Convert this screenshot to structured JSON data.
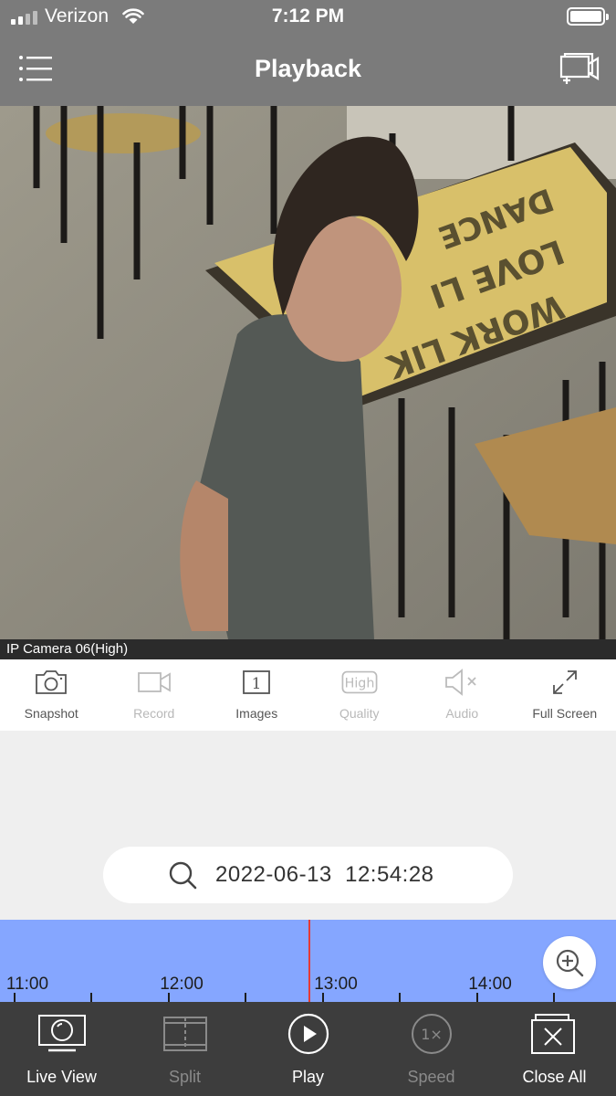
{
  "status_bar": {
    "carrier": "Verizon",
    "time": "7:12 PM"
  },
  "header": {
    "title": "Playback",
    "menu_icon": "hamburger-menu-icon",
    "add_window_icon": "add-window-icon"
  },
  "video": {
    "camera_label": "IP Camera 06(High)"
  },
  "toolbar": {
    "items": [
      {
        "label": "Snapshot",
        "icon": "camera-icon",
        "enabled": true
      },
      {
        "label": "Record",
        "icon": "video-camera-icon",
        "enabled": false
      },
      {
        "label": "Images",
        "icon": "images-icon",
        "enabled": true,
        "badge": "1"
      },
      {
        "label": "Quality",
        "icon": "quality-icon",
        "enabled": false,
        "badge": "High"
      },
      {
        "label": "Audio",
        "icon": "mute-icon",
        "enabled": false
      },
      {
        "label": "Full Screen",
        "icon": "fullscreen-icon",
        "enabled": true
      }
    ]
  },
  "search": {
    "datetime": "2022-06-13  12:54:28"
  },
  "timeline": {
    "labels": [
      "11:00",
      "12:00",
      "13:00",
      "14:00"
    ],
    "colors": {
      "track": "#85a6ff",
      "needle": "#e53935"
    }
  },
  "bottom_nav": {
    "items": [
      {
        "label": "Live View",
        "icon": "monitor-icon",
        "enabled": true
      },
      {
        "label": "Split",
        "icon": "split-icon",
        "enabled": false
      },
      {
        "label": "Play",
        "icon": "play-icon",
        "enabled": true
      },
      {
        "label": "Speed",
        "icon": "speed-icon",
        "enabled": false,
        "badge": "1×"
      },
      {
        "label": "Close All",
        "icon": "close-all-icon",
        "enabled": true
      }
    ]
  }
}
